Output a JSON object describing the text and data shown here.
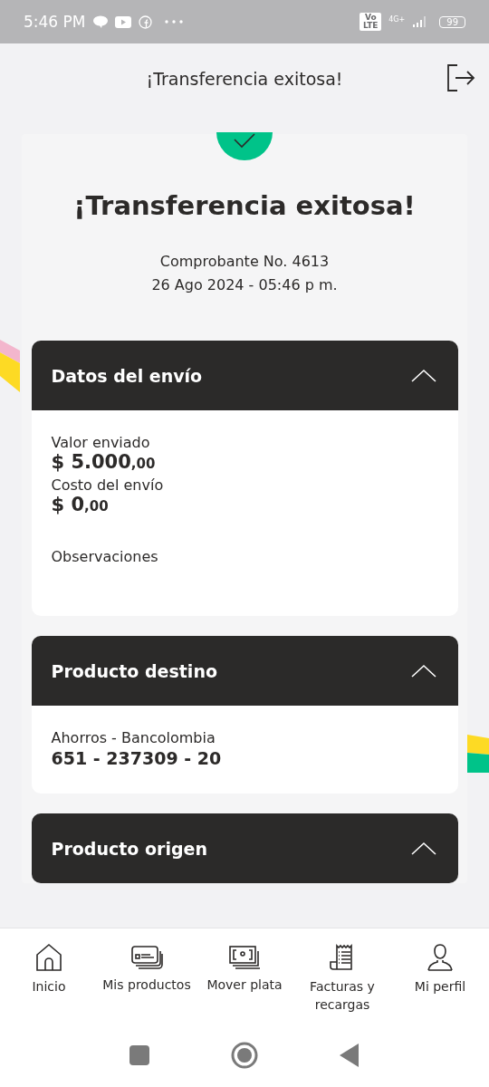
{
  "status_bar": {
    "time": "5:46 PM",
    "network": "4G+",
    "volte": "Vo LTE",
    "battery": "99"
  },
  "header": {
    "title": "¡Transferencia exitosa!"
  },
  "receipt": {
    "title": "¡Transferencia exitosa!",
    "voucher": "Comprobante No. 4613",
    "date": "26 Ago 2024 - 05:46 p m."
  },
  "sections": [
    {
      "title": "Datos del envío",
      "expanded": true,
      "fields": [
        {
          "kind": "amount",
          "label": "Valor enviado",
          "value": "$ 5.000",
          "cents": ",00"
        },
        {
          "kind": "amount",
          "label": "Costo del envío",
          "value": "$ 0",
          "cents": ",00"
        },
        {
          "kind": "note",
          "label": "Observaciones"
        }
      ]
    },
    {
      "title": "Producto destino",
      "expanded": true,
      "fields": [
        {
          "kind": "account",
          "label": "Ahorros - Bancolombia",
          "value": "651 - 237309 - 20"
        }
      ]
    },
    {
      "title": "Producto origen",
      "expanded": true
    }
  ],
  "bottom_nav": [
    {
      "kind": "home",
      "label": "Inicio",
      "selected": false
    },
    {
      "kind": "cards",
      "label": "Mis productos",
      "selected": false
    },
    {
      "kind": "cash",
      "label": "Mover plata",
      "selected": false
    },
    {
      "kind": "receipt",
      "label": "Facturas y recargas",
      "selected": false
    },
    {
      "kind": "user",
      "label": "Mi perfil",
      "selected": false
    }
  ]
}
